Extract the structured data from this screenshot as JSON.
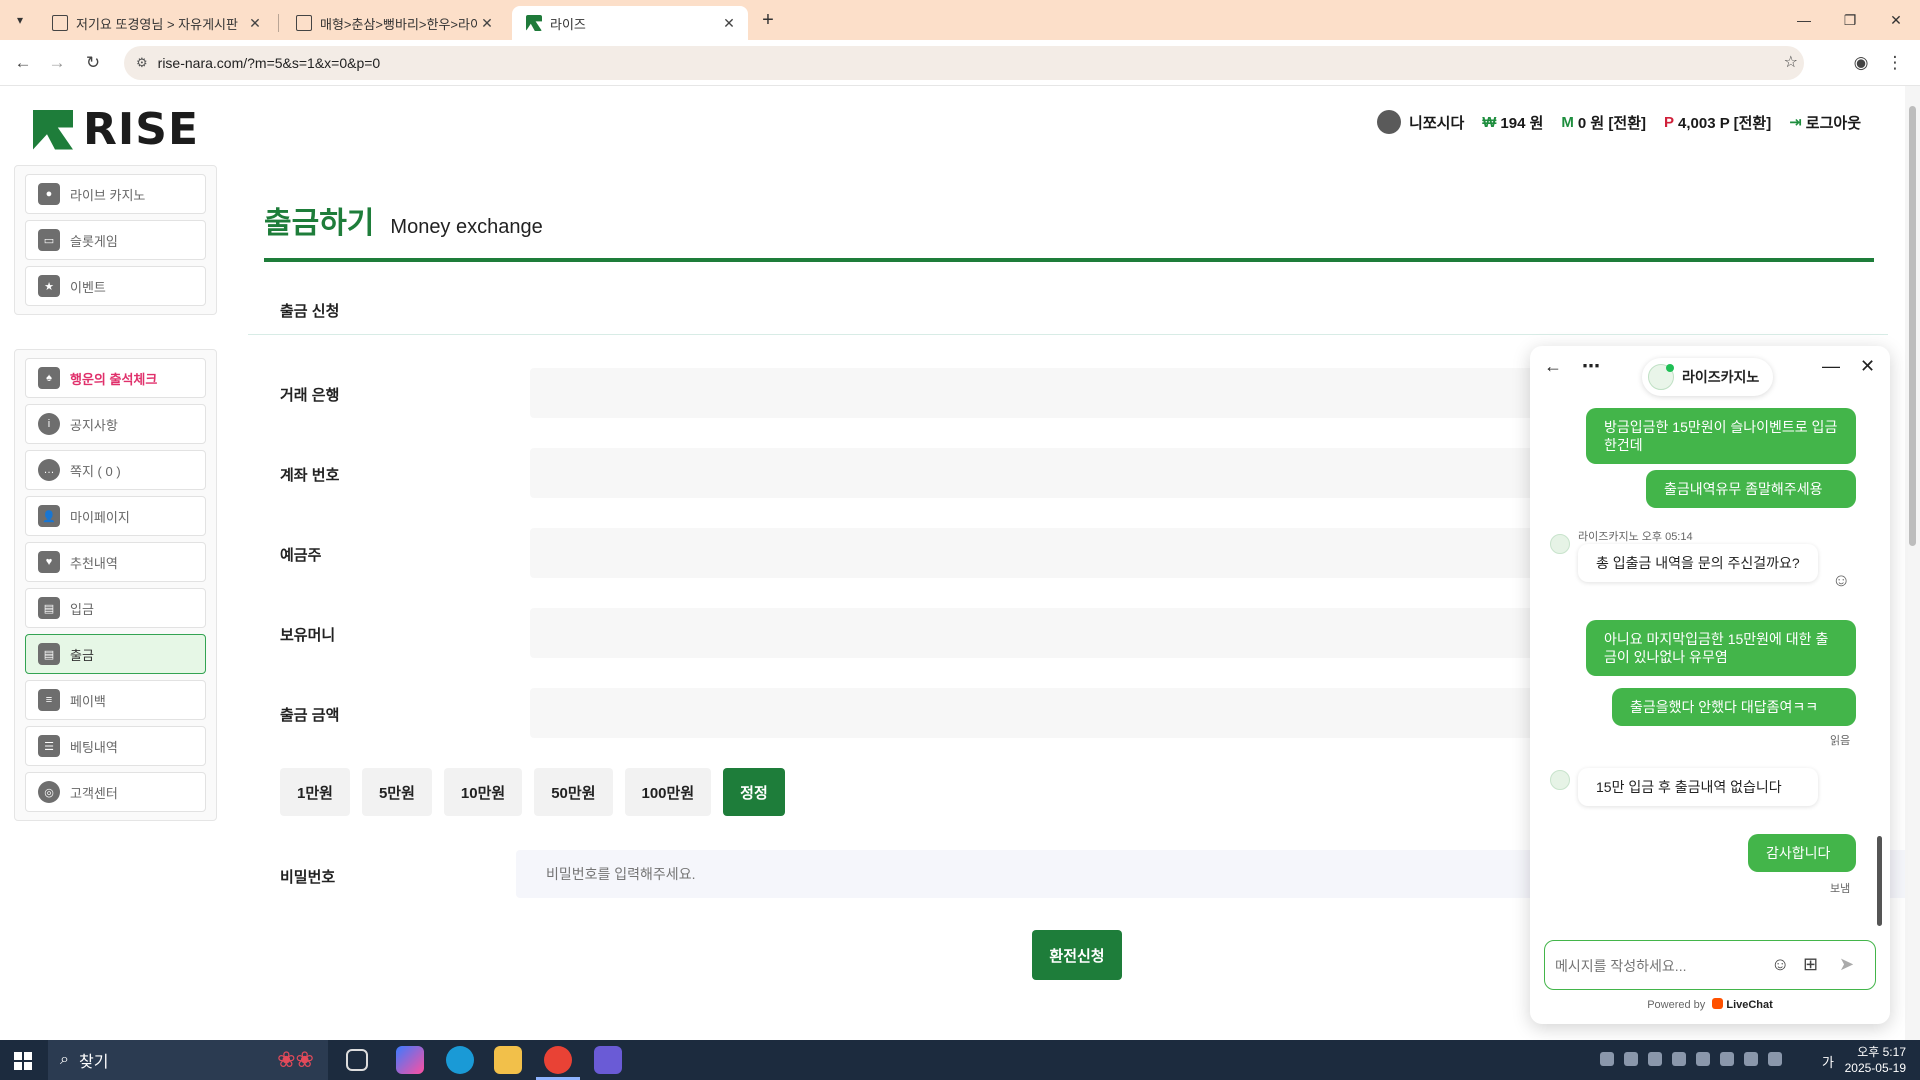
{
  "browser": {
    "tabs": [
      {
        "title": "저기요 또경영님 > 자유게시판",
        "active": false
      },
      {
        "title": "매형>춘삼>뻥바리>한우>라이",
        "active": false
      },
      {
        "title": "라이즈",
        "active": true
      }
    ],
    "url": "rise-nara.com/?m=5&s=1&x=0&p=0"
  },
  "header": {
    "logo_text": "RISE",
    "username": "니쪼시다",
    "money_symbol": "₩",
    "money": "194 원",
    "m_symbol": "M",
    "m_balance": "0 원 [전환]",
    "point_symbol": "P",
    "points": "4,003 P [전환]",
    "logout": "로그아웃"
  },
  "sidebar": {
    "games": [
      {
        "label": "라이브 카지노"
      },
      {
        "label": "슬롯게임"
      },
      {
        "label": "이벤트"
      }
    ],
    "menu": [
      {
        "label": "행운의 출석체크"
      },
      {
        "label": "공지사항"
      },
      {
        "label": "쪽지 ( 0 )"
      },
      {
        "label": "마이페이지"
      },
      {
        "label": "추천내역"
      },
      {
        "label": "입금"
      },
      {
        "label": "출금"
      },
      {
        "label": "페이백"
      },
      {
        "label": "베팅내역"
      },
      {
        "label": "고객센터"
      }
    ]
  },
  "main": {
    "title_ko": "출금하기",
    "title_en": "Money exchange",
    "section": "출금 신청",
    "fields": [
      {
        "label": "거래 은행"
      },
      {
        "label": "계좌 번호"
      },
      {
        "label": "예금주"
      },
      {
        "label": "보유머니"
      },
      {
        "label": "출금 금액"
      }
    ],
    "amount_buttons": [
      "1만원",
      "5만원",
      "10만원",
      "50만원",
      "100만원",
      "정정"
    ],
    "password_label": "비밀번호",
    "password_placeholder": "비밀번호를 입력해주세요.",
    "submit": "환전신청"
  },
  "chat": {
    "agent_name": "라이즈카지노",
    "messages": [
      {
        "from": "user",
        "text": "방금입금한 15만원이 슬나이벤트로 입금한건데"
      },
      {
        "from": "user",
        "text": "출금내역유무 좀말해주세용"
      },
      {
        "from": "agent",
        "meta": "라이즈카지노 오후 05:14",
        "text": "총 입출금 내역을 문의 주신걸까요?"
      },
      {
        "from": "user",
        "text": "아니요 마지막입금한 15만원에 대한 출금이 있나없나 유무염"
      },
      {
        "from": "user",
        "text": "출금을했다 안했다 대답좀여ㅋㅋ"
      },
      {
        "from": "status",
        "text": "읽음"
      },
      {
        "from": "agent",
        "text": "15만 입금 후 출금내역 없습니다"
      },
      {
        "from": "user",
        "text": "감사합니다"
      },
      {
        "from": "status",
        "text": "보냄"
      }
    ],
    "composer_placeholder": "메시지를 작성하세요...",
    "powered_by": "Powered by",
    "powered_brand": "LiveChat"
  },
  "taskbar": {
    "search": "찾기",
    "time": "오후 5:17",
    "date": "2025-05-19",
    "ime": "가"
  }
}
